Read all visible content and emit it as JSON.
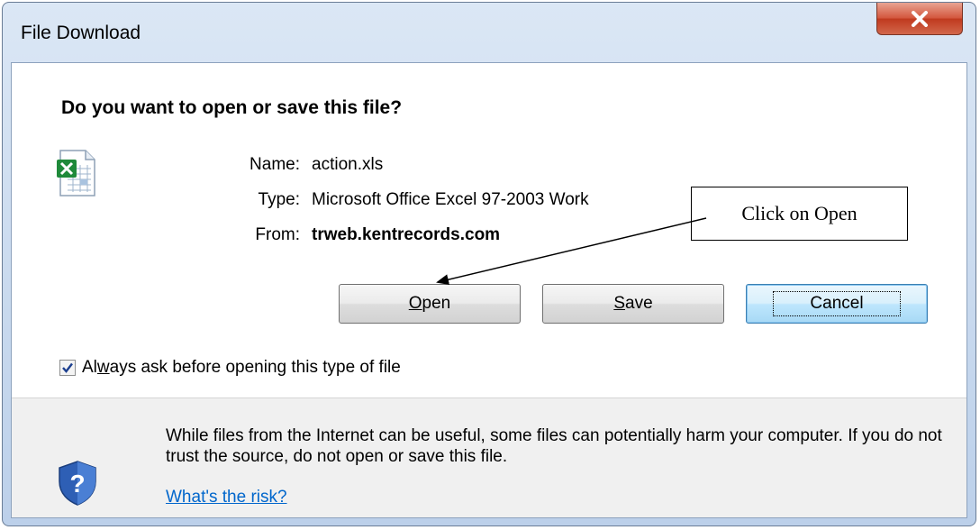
{
  "window": {
    "title": "File Download"
  },
  "dialog": {
    "question": "Do you want to open or save this file?",
    "file_icon": "excel-file-icon",
    "fields": {
      "name_label": "Name:",
      "name_value": "action.xls",
      "type_label": "Type:",
      "type_value": "Microsoft Office Excel 97-2003 Work",
      "from_label": "From:",
      "from_value": "trweb.kentrecords.com"
    },
    "buttons": {
      "open_mnemonic": "O",
      "open_rest": "pen",
      "save_mnemonic": "S",
      "save_rest": "ave",
      "cancel": "Cancel"
    },
    "checkbox": {
      "checked": true,
      "label_pre": "Al",
      "label_mnemonic": "w",
      "label_post": "ays ask before opening this type of file"
    }
  },
  "warning": {
    "icon": "shield-question-icon",
    "text": "While files from the Internet can be useful, some files can potentially harm your computer. If you do not trust the source, do not open or save this file.",
    "link": "What's the risk?"
  },
  "annotation": {
    "callout_text": "Click on Open"
  },
  "colors": {
    "titlebar": "#c8d9ee",
    "close_button": "#c8452a",
    "link": "#0066cc",
    "default_button_border": "#3c7fb1"
  }
}
